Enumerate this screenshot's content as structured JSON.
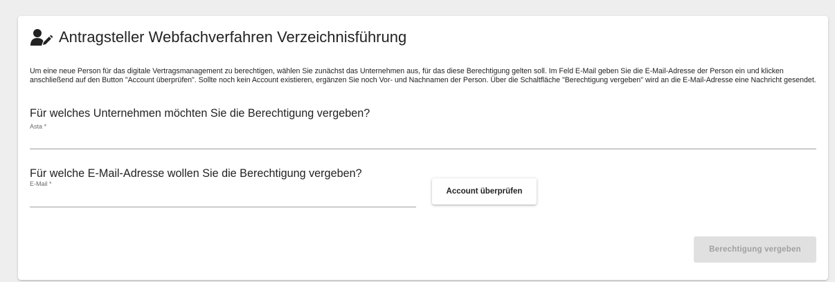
{
  "header": {
    "icon": "user-edit-icon",
    "title": "Antragsteller Webfachverfahren Verzeichnisführung"
  },
  "intro": {
    "text": "Um eine neue Person für das digitale Vertragsmanagement zu berechtigen, wählen Sie zunächst das Unternehmen aus, für das diese Berechtigung gelten soll. Im Feld E-Mail geben Sie die E-Mail-Adresse der Person ein und klicken anschließend auf den Button \"Account überprüfen\". Sollte noch kein Account existieren, ergänzen Sie noch Vor- und Nachnamen der Person. Über die Schaltfläche \"Berechtigung vergeben\" wird an die E-Mail-Adresse eine Nachricht gesendet."
  },
  "company": {
    "question": "Für welches Unternehmen möchten Sie die Berechtigung vergeben?",
    "label": "Asta *",
    "value": ""
  },
  "email": {
    "question": "Für welche E-Mail-Adresse wollen Sie die Berechtigung vergeben?",
    "label": "E-Mail *",
    "value": ""
  },
  "buttons": {
    "check_account": "Account überprüfen",
    "grant_permission": "Berechtigung vergeben",
    "grant_disabled": true
  },
  "colors": {
    "background": "#eeeeee",
    "card": "#ffffff",
    "text": "#222222",
    "disabled_button_bg": "#e0e0e0",
    "disabled_button_text": "#a0a0a0"
  }
}
